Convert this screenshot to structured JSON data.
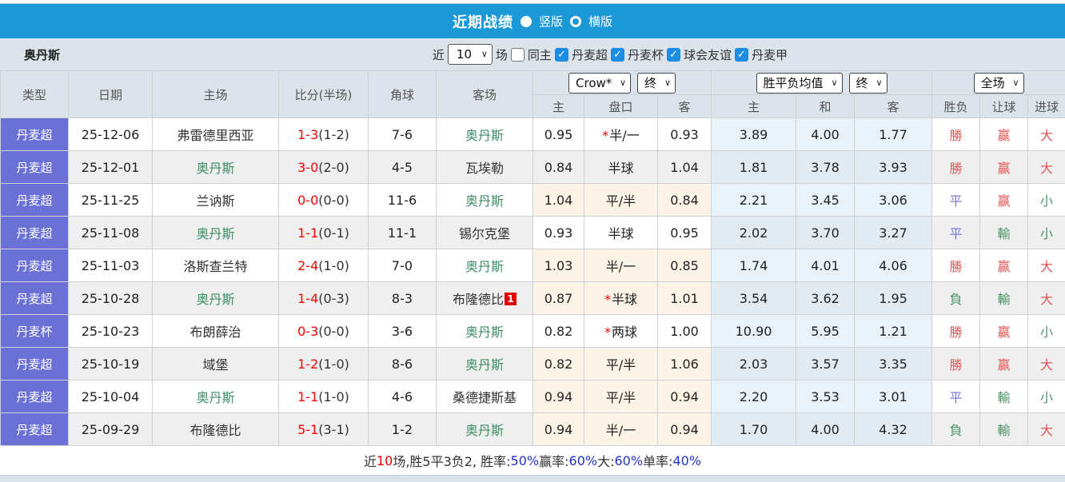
{
  "title_bar": {
    "title": "近期战绩",
    "radio_vertical": "竖版",
    "radio_horizontal": "横版"
  },
  "filter_bar": {
    "team": "奥丹斯",
    "near_label": "近",
    "count_value": "10",
    "games_label": "场",
    "same_home_label": "同主",
    "leagues": [
      "丹麦超",
      "丹麦杯",
      "球会友谊",
      "丹麦甲"
    ]
  },
  "table": {
    "static_headers": [
      "类型",
      "日期",
      "主场",
      "比分(半场)",
      "角球",
      "客场"
    ],
    "dropdowns": {
      "company": "Crow*",
      "company_period": "终",
      "avg": "胜平负均值",
      "avg_period": "终",
      "scope": "全场"
    },
    "sub_headers": [
      "主",
      "盘口",
      "客",
      "主",
      "和",
      "客",
      "胜负",
      "让球",
      "进球"
    ],
    "rows": [
      {
        "league": "丹麦超",
        "date": "25-12-06",
        "home": "弗雷德里西亚",
        "home_is_focus": false,
        "score": "1-3",
        "half": "(1-2)",
        "corners": "7-6",
        "away": "奥丹斯",
        "away_is_focus": true,
        "away_badge": "",
        "odds_home": "0.95",
        "handicap": "半/一",
        "handicap_star": true,
        "odds_away": "0.93",
        "avg_home": "3.89",
        "avg_draw": "4.00",
        "avg_away": "1.77",
        "result": "勝",
        "result_color": "red",
        "handicap_result": "赢",
        "handicap_result_color": "red",
        "goals": "大",
        "goals_color": "red",
        "odds_bg": "white"
      },
      {
        "league": "丹麦超",
        "date": "25-12-01",
        "home": "奥丹斯",
        "home_is_focus": true,
        "score": "3-0",
        "half": "(2-0)",
        "corners": "4-5",
        "away": "瓦埃勒",
        "away_is_focus": false,
        "away_badge": "",
        "odds_home": "0.84",
        "handicap": "半球",
        "handicap_star": false,
        "odds_away": "1.04",
        "avg_home": "1.81",
        "avg_draw": "3.78",
        "avg_away": "3.93",
        "result": "勝",
        "result_color": "red",
        "handicap_result": "赢",
        "handicap_result_color": "red",
        "goals": "大",
        "goals_color": "red",
        "odds_bg": "stripe"
      },
      {
        "league": "丹麦超",
        "date": "25-11-25",
        "home": "兰讷斯",
        "home_is_focus": false,
        "score": "0-0",
        "half": "(0-0)",
        "corners": "11-6",
        "away": "奥丹斯",
        "away_is_focus": true,
        "away_badge": "",
        "odds_home": "1.04",
        "handicap": "平/半",
        "handicap_star": false,
        "odds_away": "0.84",
        "avg_home": "2.21",
        "avg_draw": "3.45",
        "avg_away": "3.06",
        "result": "平",
        "result_color": "blue",
        "handicap_result": "赢",
        "handicap_result_color": "red",
        "goals": "小",
        "goals_color": "green",
        "odds_bg": "cream"
      },
      {
        "league": "丹麦超",
        "date": "25-11-08",
        "home": "奥丹斯",
        "home_is_focus": true,
        "score": "1-1",
        "half": "(0-1)",
        "corners": "11-1",
        "away": "锡尔克堡",
        "away_is_focus": false,
        "away_badge": "",
        "odds_home": "0.93",
        "handicap": "半球",
        "handicap_star": false,
        "odds_away": "0.95",
        "avg_home": "2.02",
        "avg_draw": "3.70",
        "avg_away": "3.27",
        "result": "平",
        "result_color": "blue",
        "handicap_result": "輸",
        "handicap_result_color": "green",
        "goals": "小",
        "goals_color": "green",
        "odds_bg": "white"
      },
      {
        "league": "丹麦超",
        "date": "25-11-03",
        "home": "洛斯查兰特",
        "home_is_focus": false,
        "score": "2-4",
        "half": "(1-0)",
        "corners": "7-0",
        "away": "奥丹斯",
        "away_is_focus": true,
        "away_badge": "",
        "odds_home": "1.03",
        "handicap": "半/一",
        "handicap_star": false,
        "odds_away": "0.85",
        "avg_home": "1.74",
        "avg_draw": "4.01",
        "avg_away": "4.06",
        "result": "勝",
        "result_color": "red",
        "handicap_result": "赢",
        "handicap_result_color": "red",
        "goals": "大",
        "goals_color": "red",
        "odds_bg": "cream"
      },
      {
        "league": "丹麦超",
        "date": "25-10-28",
        "home": "奥丹斯",
        "home_is_focus": true,
        "score": "1-4",
        "half": "(0-3)",
        "corners": "8-3",
        "away": "布隆德比",
        "away_is_focus": false,
        "away_badge": "1",
        "odds_home": "0.87",
        "handicap": "半球",
        "handicap_star": true,
        "odds_away": "1.01",
        "avg_home": "3.54",
        "avg_draw": "3.62",
        "avg_away": "1.95",
        "result": "負",
        "result_color": "green",
        "handicap_result": "輸",
        "handicap_result_color": "green",
        "goals": "大",
        "goals_color": "red",
        "odds_bg": "cream"
      },
      {
        "league": "丹麦杯",
        "date": "25-10-23",
        "home": "布朗薛治",
        "home_is_focus": false,
        "score": "0-3",
        "half": "(0-0)",
        "corners": "3-6",
        "away": "奥丹斯",
        "away_is_focus": true,
        "away_badge": "",
        "odds_home": "0.82",
        "handicap": "两球",
        "handicap_star": true,
        "odds_away": "1.00",
        "avg_home": "10.90",
        "avg_draw": "5.95",
        "avg_away": "1.21",
        "result": "勝",
        "result_color": "red",
        "handicap_result": "赢",
        "handicap_result_color": "red",
        "goals": "小",
        "goals_color": "green",
        "odds_bg": "white"
      },
      {
        "league": "丹麦超",
        "date": "25-10-19",
        "home": "域堡",
        "home_is_focus": false,
        "score": "1-2",
        "half": "(1-0)",
        "corners": "8-6",
        "away": "奥丹斯",
        "away_is_focus": true,
        "away_badge": "",
        "odds_home": "0.82",
        "handicap": "平/半",
        "handicap_star": false,
        "odds_away": "1.06",
        "avg_home": "2.03",
        "avg_draw": "3.57",
        "avg_away": "3.35",
        "result": "勝",
        "result_color": "red",
        "handicap_result": "赢",
        "handicap_result_color": "red",
        "goals": "大",
        "goals_color": "red",
        "odds_bg": "cream"
      },
      {
        "league": "丹麦超",
        "date": "25-10-04",
        "home": "奥丹斯",
        "home_is_focus": true,
        "score": "1-1",
        "half": "(1-0)",
        "corners": "4-6",
        "away": "桑德捷斯基",
        "away_is_focus": false,
        "away_badge": "",
        "odds_home": "0.94",
        "handicap": "平/半",
        "handicap_star": false,
        "odds_away": "0.94",
        "avg_home": "2.20",
        "avg_draw": "3.53",
        "avg_away": "3.01",
        "result": "平",
        "result_color": "blue",
        "handicap_result": "輸",
        "handicap_result_color": "green",
        "goals": "小",
        "goals_color": "green",
        "odds_bg": "cream"
      },
      {
        "league": "丹麦超",
        "date": "25-09-29",
        "home": "布隆德比",
        "home_is_focus": false,
        "score": "5-1",
        "half": "(3-1)",
        "corners": "1-2",
        "away": "奥丹斯",
        "away_is_focus": true,
        "away_badge": "",
        "odds_home": "0.94",
        "handicap": "半/一",
        "handicap_star": false,
        "odds_away": "0.94",
        "avg_home": "1.70",
        "avg_draw": "4.00",
        "avg_away": "4.32",
        "result": "負",
        "result_color": "green",
        "handicap_result": "輸",
        "handicap_result_color": "green",
        "goals": "大",
        "goals_color": "red",
        "odds_bg": "cream"
      }
    ]
  },
  "summary": {
    "segments": [
      {
        "text": "近",
        "color": "dark"
      },
      {
        "text": "10",
        "color": "red"
      },
      {
        "text": "场,胜5平3负2, 胜率:",
        "color": "dark"
      },
      {
        "text": "50%",
        "color": "blue"
      },
      {
        "text": " 赢率:",
        "color": "dark"
      },
      {
        "text": "60%",
        "color": "blue"
      },
      {
        "text": " 大:",
        "color": "dark"
      },
      {
        "text": "60%",
        "color": "blue"
      },
      {
        "text": " 单率:",
        "color": "dark"
      },
      {
        "text": "40%",
        "color": "blue"
      }
    ]
  },
  "colors": {
    "title_bar_blue": "#1a99d6",
    "league_cell_purple": "#6a70d4",
    "focus_team_green": "#3f8e68",
    "score_red": "#ff0000",
    "result_red": "#e25555",
    "result_blue": "#7777dd",
    "result_green": "#4e9468",
    "avg_col_blue_bg": "#e9f2f9",
    "odds_cream_bg": "#faf3e6",
    "header_bg": "#dce3ea",
    "summary_blue": "#2233cc",
    "checkbox_blue": "#1d8de4"
  }
}
